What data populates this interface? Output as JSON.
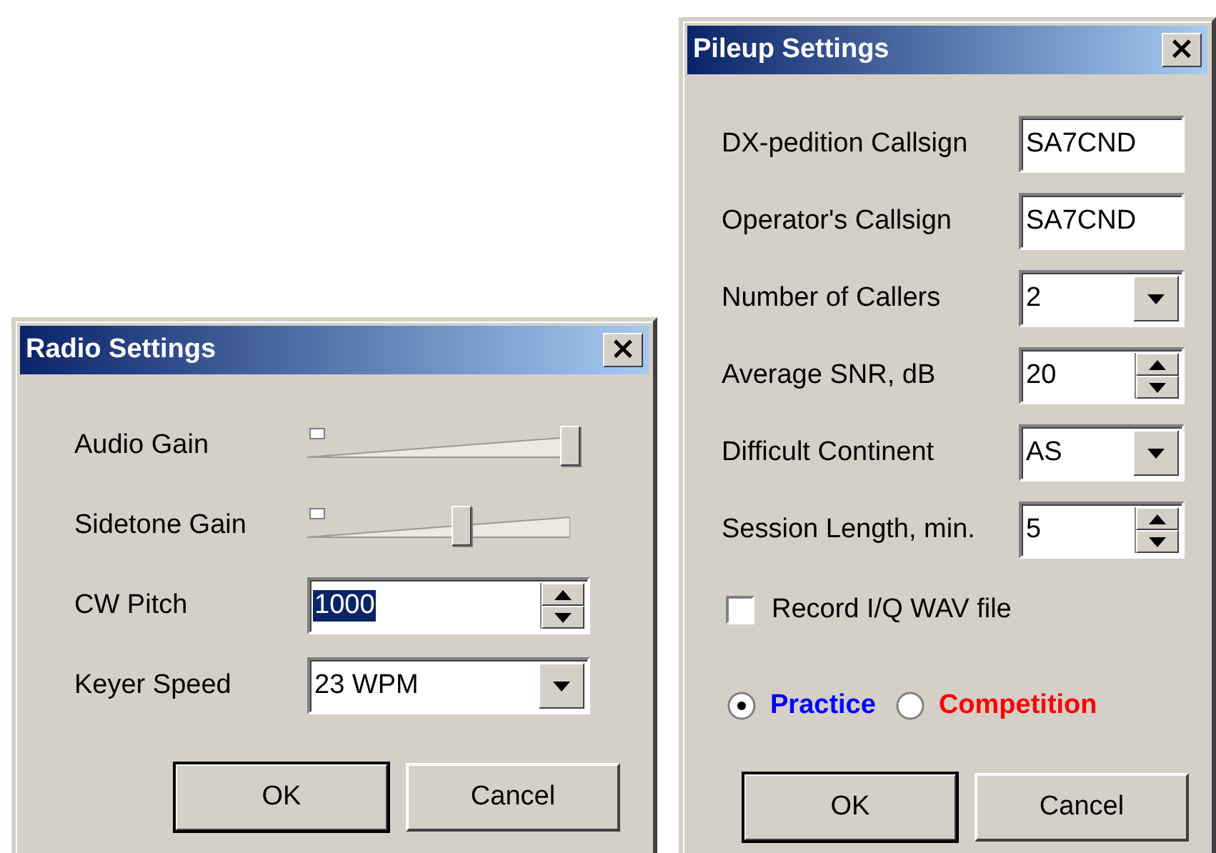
{
  "dialogs": [
    {
      "title": "Radio Settings",
      "close": "×",
      "rows": [
        {
          "label": "Audio Gain",
          "kind": "slider",
          "level": 1.0
        },
        {
          "label": "Sidetone Gain",
          "kind": "slider",
          "level": 0.57
        },
        {
          "label": "CW Pitch",
          "kind": "spin",
          "value": "1000",
          "highlighted": true
        },
        {
          "label": "Keyer Speed",
          "kind": "dropdown",
          "value": "23 WPM",
          "highlighted": false
        }
      ],
      "buttons": [
        {
          "label": "OK",
          "default": true
        },
        {
          "label": "Cancel",
          "default": false
        }
      ]
    },
    {
      "title": "Pileup Settings",
      "close": "×",
      "rows": [
        {
          "label": "DX-pedition Callsign",
          "kind": "text",
          "value": "SA7CND",
          "highlighted": false
        },
        {
          "label": "Operator's Callsign",
          "kind": "text",
          "value": "SA7CND",
          "highlighted": false
        },
        {
          "label": "Number of Callers",
          "kind": "dropdown",
          "value": "2",
          "highlighted": false
        },
        {
          "label": "Average SNR, dB",
          "kind": "spin",
          "value": "20",
          "highlighted": false
        },
        {
          "label": "Difficult Continent",
          "kind": "dropdown",
          "value": "AS",
          "highlighted": false
        },
        {
          "label": "Session Length, min.",
          "kind": "spin",
          "value": "5",
          "highlighted": false
        }
      ],
      "checkboxes": [
        {
          "label": "Record I/Q WAV file",
          "checked": false
        }
      ],
      "modes": [
        {
          "label": "Practice",
          "selected": true,
          "color": "#0000ff"
        },
        {
          "label": "Competition",
          "selected": false,
          "color": "#ff0000"
        }
      ],
      "buttons": [
        {
          "label": "OK",
          "default": true
        },
        {
          "label": "Cancel",
          "default": false
        }
      ]
    }
  ]
}
